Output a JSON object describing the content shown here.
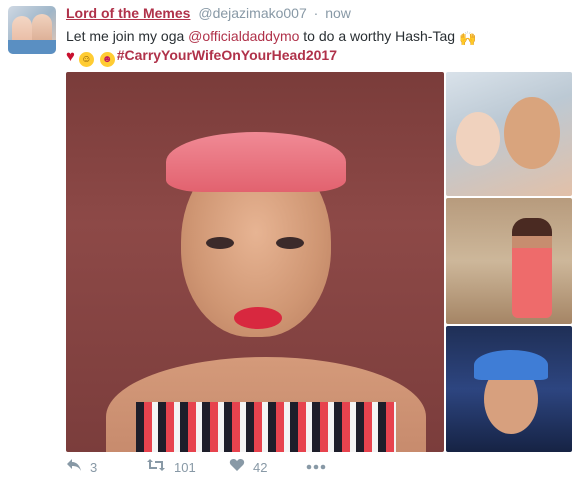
{
  "tweet": {
    "display_name": "Lord of the Memes",
    "handle": "@dejazimako007",
    "separator": "·",
    "time": "now",
    "text_before_mention": "Let me join my oga ",
    "mention": "@officialdaddymo",
    "text_after_mention": "  to do a worthy Hash-Tag",
    "hashtag": "#CarryYourWifeOnYourHead2017"
  },
  "actions": {
    "reply_count": "3",
    "retweet_count": "101",
    "like_count": "42"
  },
  "colors": {
    "accent": "#b0324a",
    "muted": "#8899a6"
  }
}
